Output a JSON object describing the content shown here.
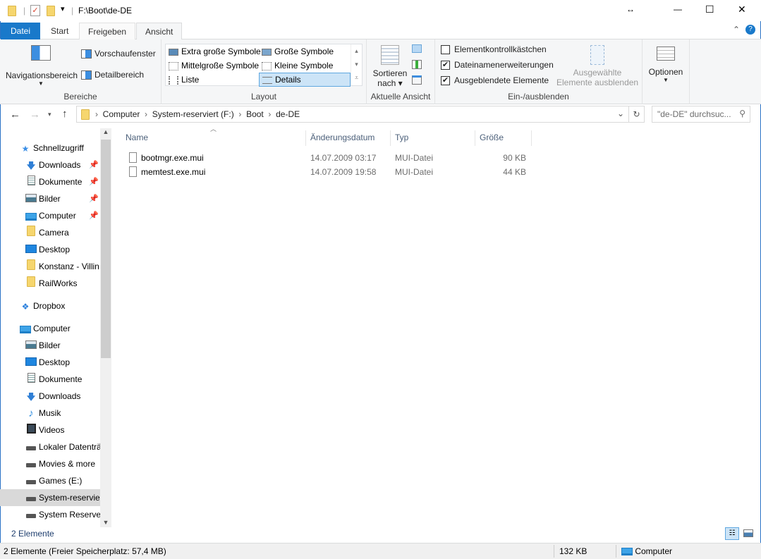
{
  "window": {
    "title": "F:\\Boot\\de-DE",
    "controls": [
      "↔",
      "—",
      "☐",
      "✕"
    ]
  },
  "tabs": [
    {
      "label": "Datei"
    },
    {
      "label": "Start"
    },
    {
      "label": "Freigeben"
    },
    {
      "label": "Ansicht"
    }
  ],
  "ribbon": {
    "bereiche": {
      "label": "Bereiche",
      "nav": "Navigationsbereich",
      "preview": "Vorschaufenster",
      "details": "Detailbereich"
    },
    "layout": {
      "label": "Layout",
      "items": [
        "Extra große Symbole",
        "Große Symbole",
        "Mittelgroße Symbole",
        "Kleine Symbole",
        "Liste",
        "Details"
      ],
      "selected": "Details"
    },
    "ansicht": {
      "label": "Aktuelle Ansicht",
      "sort1": "Sortieren",
      "sort2": "nach"
    },
    "einaus": {
      "label": "Ein-/ausblenden",
      "checks": [
        {
          "label": "Elementkontrollkästchen",
          "checked": false
        },
        {
          "label": "Dateinamenerweiterungen",
          "checked": true
        },
        {
          "label": "Ausgeblendete Elemente",
          "checked": true
        }
      ],
      "hide1": "Ausgewählte",
      "hide2": "Elemente ausblenden"
    },
    "optionen": "Optionen"
  },
  "address": {
    "crumbs": [
      "Computer",
      "System-reserviert (F:)",
      "Boot",
      "de-DE"
    ],
    "search_placeholder": "\"de-DE\" durchsuc..."
  },
  "nav": [
    {
      "label": "Schnellzugriff",
      "icon": "star",
      "level": 0
    },
    {
      "label": "Downloads",
      "icon": "download",
      "level": 1,
      "pinned": true
    },
    {
      "label": "Dokumente",
      "icon": "document",
      "level": 1,
      "pinned": true
    },
    {
      "label": "Bilder",
      "icon": "pictures",
      "level": 1,
      "pinned": true
    },
    {
      "label": "Computer",
      "icon": "computer",
      "level": 1,
      "pinned": true
    },
    {
      "label": "Camera",
      "icon": "folder",
      "level": 1
    },
    {
      "label": "Desktop",
      "icon": "desktop",
      "level": 1
    },
    {
      "label": "Konstanz - Villin",
      "icon": "folder",
      "level": 1
    },
    {
      "label": "RailWorks",
      "icon": "folder",
      "level": 1
    },
    {
      "label": "Dropbox",
      "icon": "dropbox",
      "level": 0
    },
    {
      "label": "Computer",
      "icon": "computer",
      "level": 0
    },
    {
      "label": "Bilder",
      "icon": "pictures",
      "level": 1
    },
    {
      "label": "Desktop",
      "icon": "desktop",
      "level": 1
    },
    {
      "label": "Dokumente",
      "icon": "document",
      "level": 1
    },
    {
      "label": "Downloads",
      "icon": "download",
      "level": 1
    },
    {
      "label": "Musik",
      "icon": "music",
      "level": 1
    },
    {
      "label": "Videos",
      "icon": "video",
      "level": 1
    },
    {
      "label": "Lokaler Datenträ",
      "icon": "drive",
      "level": 1
    },
    {
      "label": "Movies & more",
      "icon": "drive",
      "level": 1
    },
    {
      "label": "Games (E:)",
      "icon": "drive",
      "level": 1
    },
    {
      "label": "System-reservier",
      "icon": "drive",
      "level": 1,
      "selected": true
    },
    {
      "label": "System Reservec",
      "icon": "drive",
      "level": 1
    }
  ],
  "columns": [
    "Name",
    "Änderungsdatum",
    "Typ",
    "Größe"
  ],
  "files": [
    {
      "name": "bootmgr.exe.mui",
      "date": "14.07.2009 03:17",
      "type": "MUI-Datei",
      "size": "90 KB"
    },
    {
      "name": "memtest.exe.mui",
      "date": "14.07.2009 19:58",
      "type": "MUI-Datei",
      "size": "44 KB"
    }
  ],
  "item_count": "2 Elemente",
  "status": {
    "left": "2 Elemente (Freier Speicherplatz: 57,4 MB)",
    "size": "132 KB",
    "location": "Computer"
  }
}
